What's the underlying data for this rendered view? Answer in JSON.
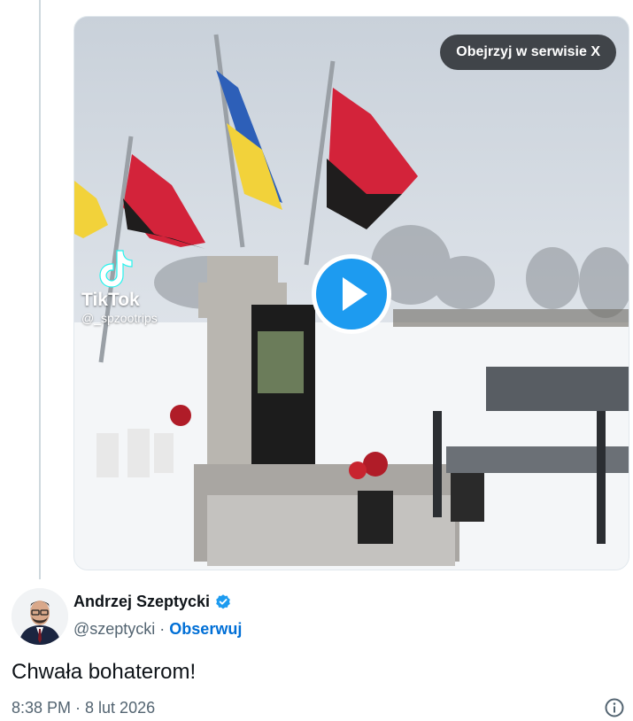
{
  "media": {
    "watch_button_label": "Obejrzyj w serwisie X",
    "watermark": {
      "brand": "TikTok",
      "handle": "@_spzootrips"
    },
    "play_color": "#1d9bf0"
  },
  "author": {
    "display_name": "Andrzej Szeptycki",
    "handle": "@szeptycki",
    "separator": "·",
    "follow_label": "Obserwuj",
    "verified_color": "#1d9bf0",
    "follow_color": "#006fd6"
  },
  "tweet": {
    "text": "Chwała bohaterom!",
    "timestamp": "8:38 PM · 8 lut 2026"
  },
  "icons": [
    "play-icon",
    "tiktok-logo-icon",
    "verified-badge-icon",
    "info-icon"
  ]
}
